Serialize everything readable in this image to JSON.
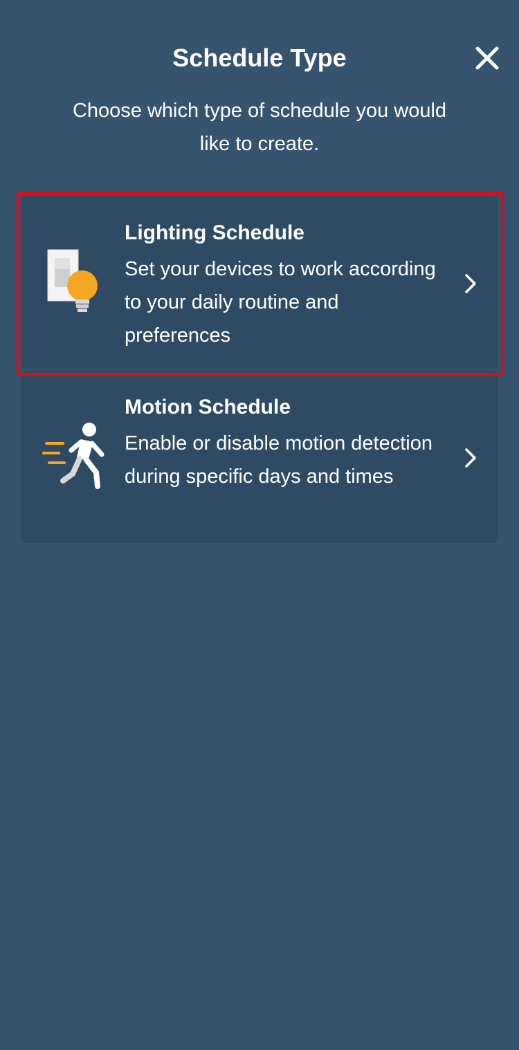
{
  "header": {
    "title": "Schedule Type",
    "close_icon": "close-icon"
  },
  "subtitle": "Choose which type of schedule you would like to create.",
  "options": [
    {
      "title": "Lighting Schedule",
      "description": "Set your devices to work according to your daily routine and preferences",
      "icon": "light-switch-bulb-icon",
      "highlighted": true
    },
    {
      "title": "Motion Schedule",
      "description": "Enable or disable motion detection during specific days and times",
      "icon": "running-person-icon",
      "highlighted": false
    }
  ],
  "colors": {
    "background": "#36546e",
    "card": "#2f4b64",
    "highlight": "#e50914",
    "bulb": "#f5a623",
    "text": "#ffffff"
  }
}
